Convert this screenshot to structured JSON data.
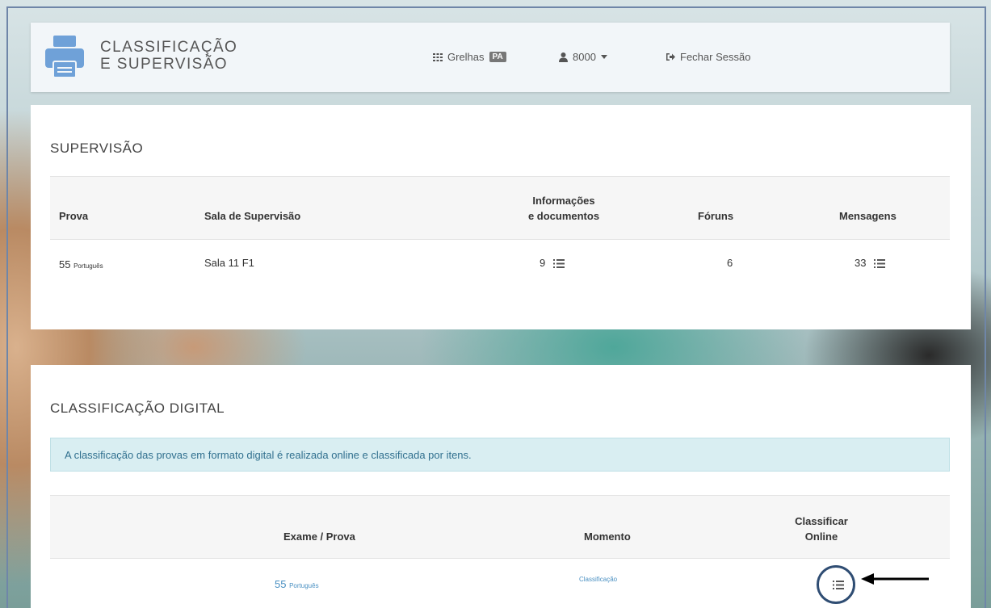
{
  "header": {
    "brand_line1": "CLASSIFICAÇÃO",
    "brand_line2": "E SUPERVISÃO",
    "nav_grelhas": "Grelhas",
    "nav_grelhas_badge": "PA",
    "nav_user": "8000",
    "nav_logout": "Fechar Sessão"
  },
  "supervisao": {
    "title": "SUPERVISÃO",
    "columns": {
      "prova": "Prova",
      "sala": "Sala de Supervisão",
      "info_line1": "Informações",
      "info_line2": "e documentos",
      "foruns": "Fóruns",
      "mensagens": "Mensagens"
    },
    "row": {
      "prova_code": "55",
      "prova_name": "Português",
      "sala": "Sala 11 F1",
      "info": "9",
      "foruns": "6",
      "mensagens": "33"
    }
  },
  "digital": {
    "title": "CLASSIFICAÇÃO DIGITAL",
    "alert": "A classificação das provas em formato digital é realizada online e classificada por itens.",
    "columns": {
      "exame": "Exame / Prova",
      "momento": "Momento",
      "classificar_line1": "Classificar",
      "classificar_line2": "Online"
    },
    "row": {
      "exame_code": "55",
      "exame_name": "Português",
      "momento": "Classificação"
    }
  },
  "colors": {
    "accent_link": "#4a90c2",
    "logo": "#6fa1d8",
    "alert_bg": "#d9eef2",
    "annotation": "#2f4d73"
  }
}
